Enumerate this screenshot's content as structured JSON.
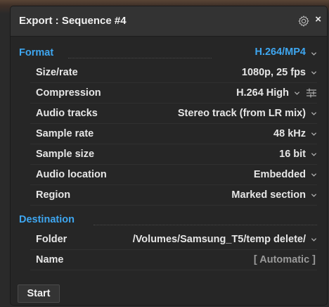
{
  "window": {
    "title": "Export : Sequence #4",
    "close_label": "×"
  },
  "format": {
    "label": "Format",
    "value": "H.264/MP4",
    "rows": [
      {
        "label": "Size/rate",
        "value": "1080p, 25 fps"
      },
      {
        "label": "Compression",
        "value": "H.264 High"
      },
      {
        "label": "Audio tracks",
        "value": "Stereo track (from LR mix)"
      },
      {
        "label": "Sample rate",
        "value": "48 kHz"
      },
      {
        "label": "Sample size",
        "value": "16 bit"
      },
      {
        "label": "Audio location",
        "value": "Embedded"
      },
      {
        "label": "Region",
        "value": "Marked section"
      }
    ]
  },
  "destination": {
    "label": "Destination",
    "rows": [
      {
        "label": "Folder",
        "value": "/Volumes/Samsung_T5/temp delete/"
      },
      {
        "label": "Name",
        "value": "[ Automatic ]"
      }
    ]
  },
  "footer": {
    "start_label": "Start"
  },
  "colors": {
    "accent": "#3ea6f0",
    "panel_bg": "#262626",
    "titlebar_bg": "#333333",
    "text": "#e6e6e6",
    "muted_text": "#9a9a9a"
  },
  "icons": {
    "settings": "gear-icon",
    "close": "close-icon",
    "dropdown": "chevron-down-icon",
    "compression_settings": "sliders-icon"
  }
}
